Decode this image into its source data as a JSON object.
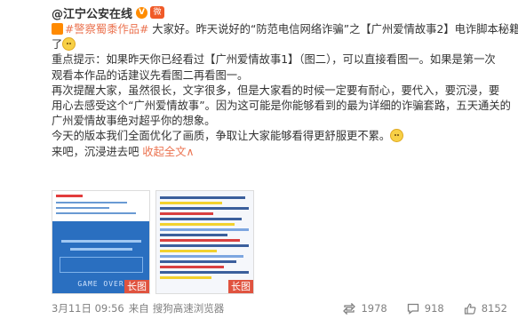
{
  "post": {
    "author": "@江宁公安在线",
    "author_badge": "V",
    "weibo_badge": "微",
    "line1": {
      "topic": "#警察蜀黍作品#",
      "text": " 大家好。昨天说好的“防范电信网络诈骗”之【广州爱情故事2】电诈脚本秘籍来"
    },
    "line2": "了",
    "line3": "重点提示：如果昨天你已经看过【广州爱情故事1】（图二），可以直接看图一。如果是第一次",
    "line4": "观看本作品的话建议先看图二再看图一。",
    "line5": "再次提醒大家，虽然很长，文字很多，但是大家看的时候一定要有耐心，要代入，要沉浸，要",
    "line6": "用心去感受这个“广州爱情故事”。因为这可能是你能够看到的最为详细的诈骗套路，五天通关的",
    "line7": "广州爱情故事绝对超乎你的想象。",
    "line8": "今天的版本我们全面优化了画质，争取让大家能够看得更舒服更不累。",
    "line9_text": "来吧，沉浸进去吧 ",
    "line9_link": "收起全文",
    "line9_link_arrow": "∧"
  },
  "images": [
    {
      "badge": "长图",
      "caption": "GAME OVER"
    },
    {
      "badge": "长图"
    }
  ],
  "footer": {
    "time": "3月11日 09:56",
    "source_prefix": "来自",
    "source": "搜狗高速浏览器",
    "repost_count": "1978",
    "comment_count": "918",
    "like_count": "8152"
  },
  "icons": {
    "repost": "repost-icon",
    "comment": "comment-icon",
    "like": "like-icon",
    "emoji": "doge-emoji-icon"
  }
}
